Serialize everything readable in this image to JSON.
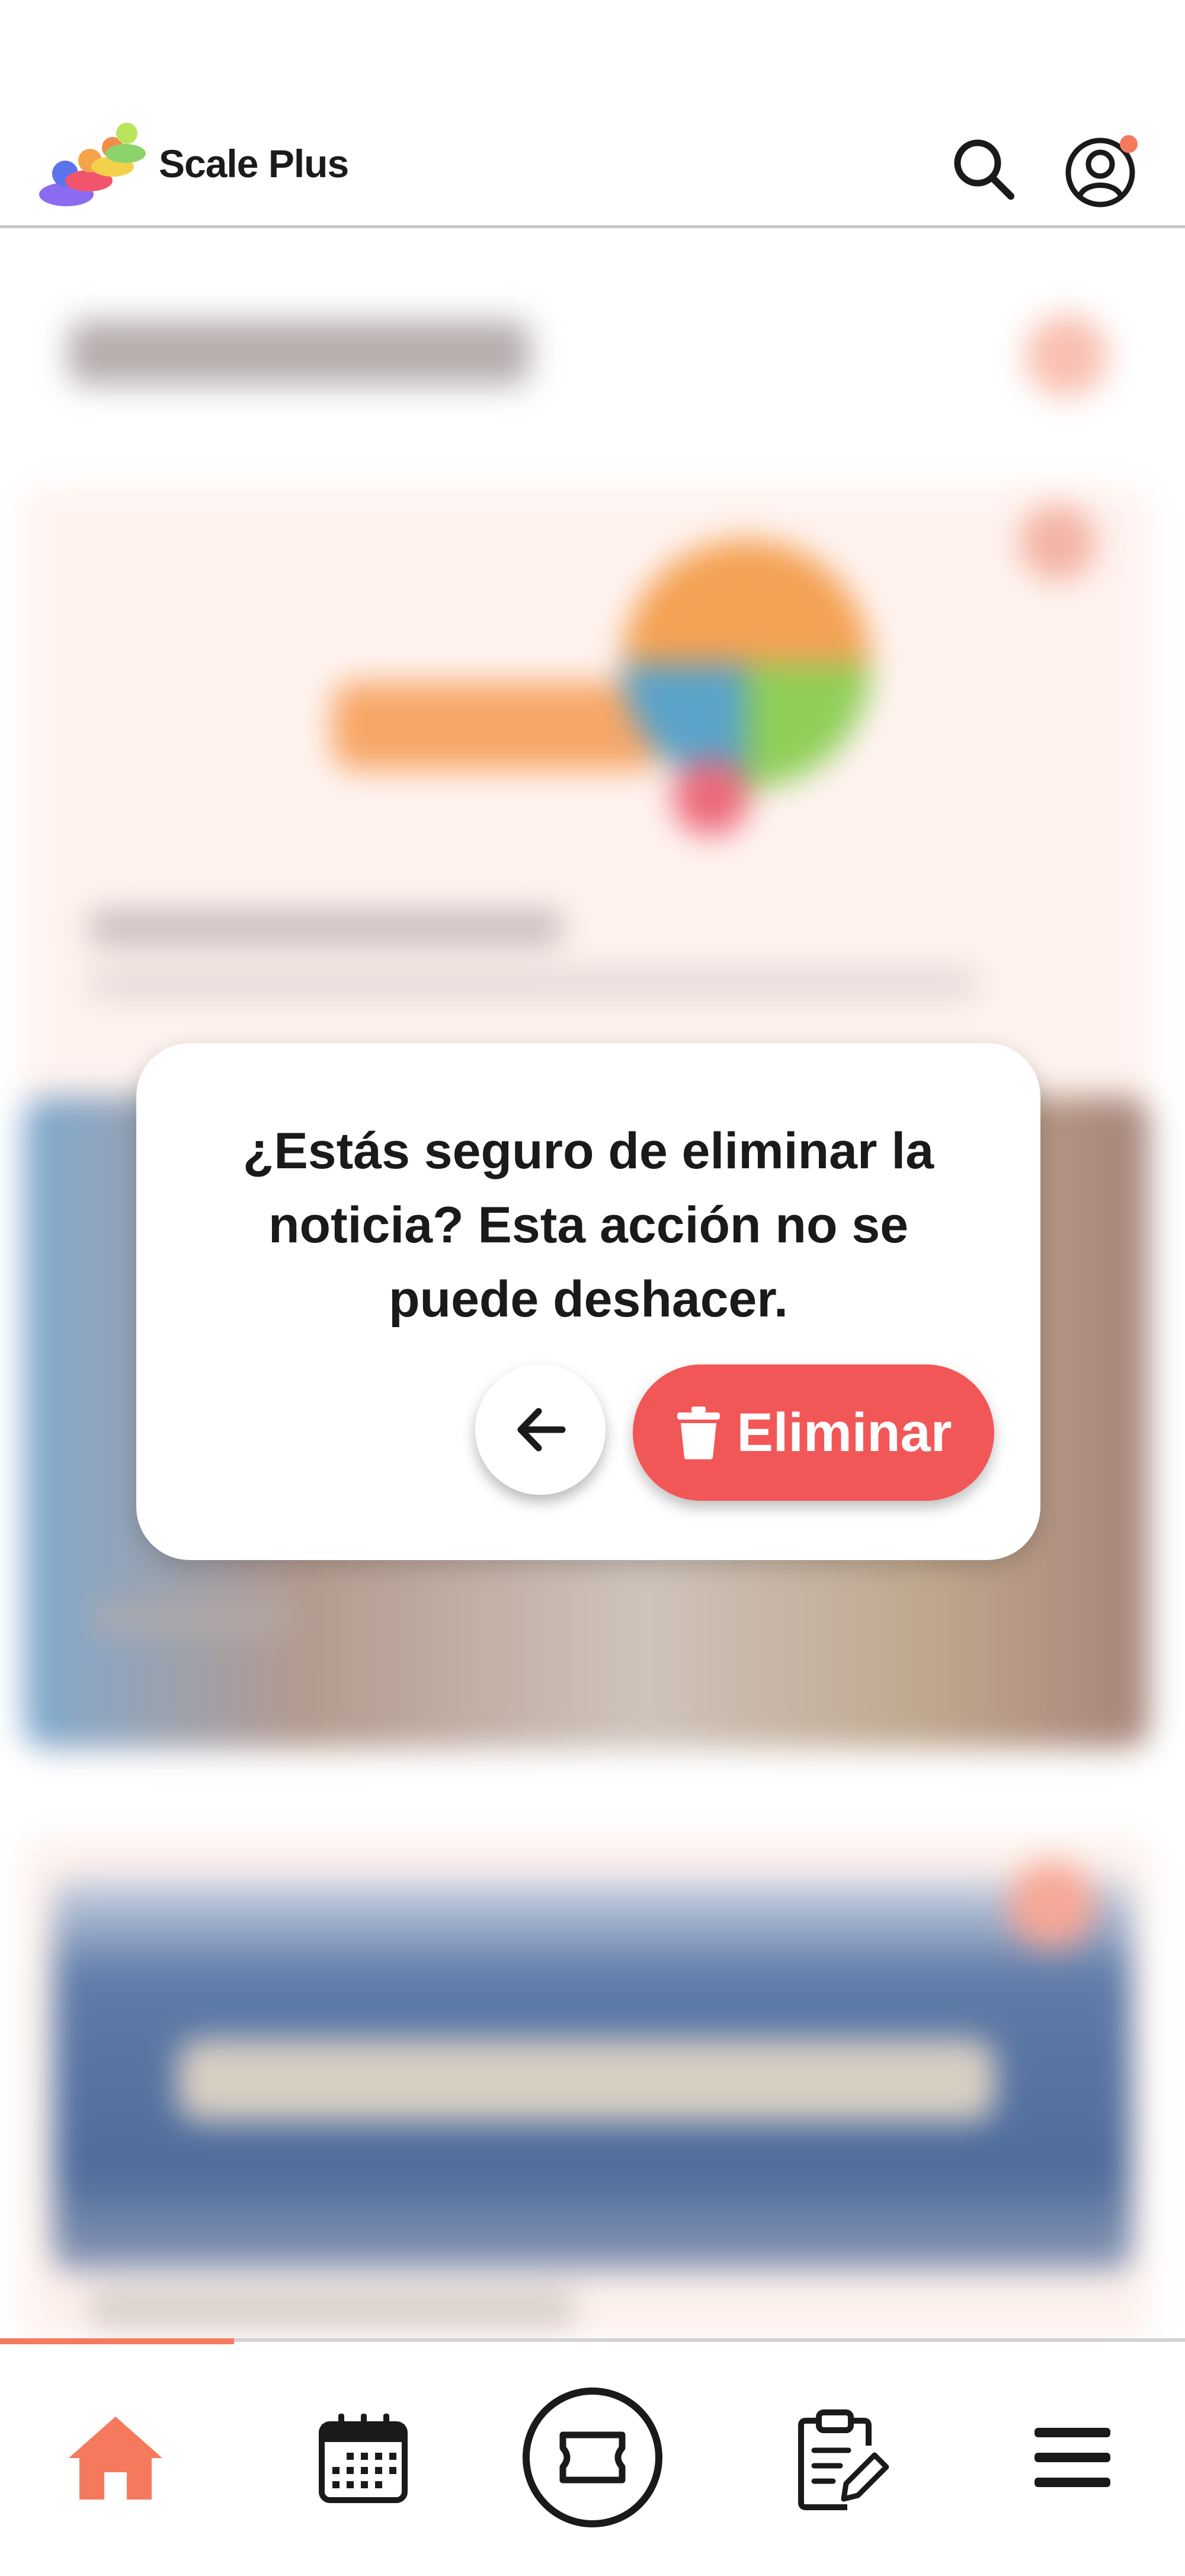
{
  "header": {
    "app_title": "Scale Plus",
    "logo_icon": "scale-plus-logo",
    "search_icon": "search-icon",
    "profile_icon": "user-account-icon",
    "notification_dot_color": "#f57a5d"
  },
  "dialog": {
    "message": "¿Estás seguro de eliminar la noticia? Esta acción no se puede deshacer.",
    "back_icon": "arrow-left-icon",
    "delete_label": "Eliminar",
    "delete_icon": "trash-icon",
    "delete_color": "#f25757"
  },
  "bottom_nav": {
    "active_index": 0,
    "accent_color": "#f57a5d",
    "items": [
      {
        "icon": "home-icon"
      },
      {
        "icon": "calendar-icon"
      },
      {
        "icon": "ticket-icon"
      },
      {
        "icon": "clipboard-edit-icon"
      },
      {
        "icon": "menu-icon"
      }
    ]
  }
}
